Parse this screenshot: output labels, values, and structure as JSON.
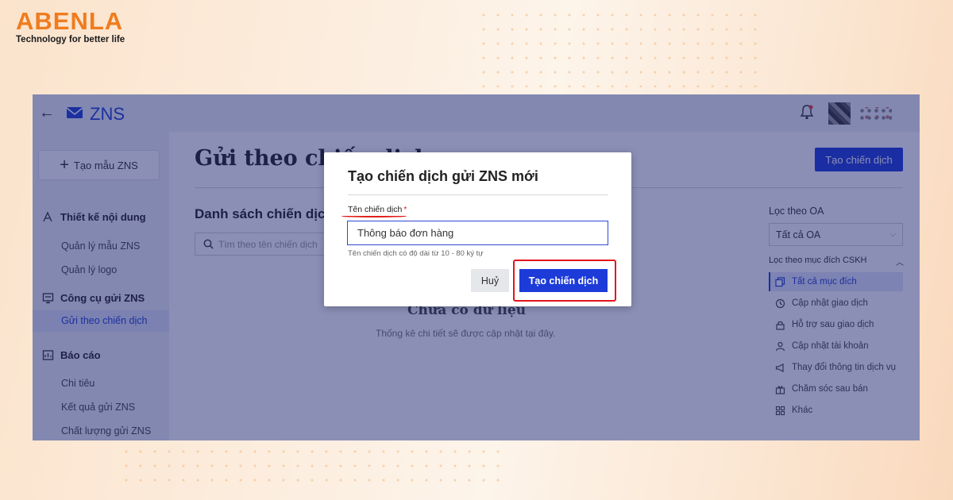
{
  "brand": {
    "name": "ABENLA",
    "tagline": "Technology for better life"
  },
  "app": {
    "title": "ZNS",
    "sidebar": {
      "create_template": "Tạo mẫu ZNS",
      "sections": [
        {
          "label": "Thiết kế nội dung",
          "items": [
            "Quản lý mẫu ZNS",
            "Quản lý logo"
          ]
        },
        {
          "label": "Công cụ gửi ZNS",
          "items": [
            "Gửi theo chiến dịch"
          ]
        },
        {
          "label": "Báo cáo",
          "items": [
            "Chi tiêu",
            "Kết quả gửi ZNS",
            "Chất lượng gửi ZNS"
          ]
        }
      ]
    },
    "main": {
      "page_title": "Gửi theo chiến dịch",
      "create_button": "Tạo chiến dịch",
      "list_title": "Danh sách chiến dịch",
      "search_placeholder": "Tìm theo tên chiến dịch",
      "empty_title": "Chưa có dữ liệu",
      "empty_desc": "Thống kê chi tiết sẽ được cập nhật tại đây."
    },
    "filters": {
      "oa_label": "Lọc theo OA",
      "oa_selected": "Tất cả OA",
      "purpose_label": "Lọc theo mục đích CSKH",
      "purposes": [
        "Tất cả mục đích",
        "Cập nhật giao dịch",
        "Hỗ trợ sau giao dịch",
        "Cập nhật tài khoản",
        "Thay đổi thông tin dịch vụ",
        "Chăm sóc sau bán",
        "Khác"
      ]
    }
  },
  "modal": {
    "title": "Tạo chiến dịch gửi ZNS mới",
    "field_label": "Tên chiến dịch",
    "required_mark": "*",
    "field_value": "Thông báo đơn hàng",
    "field_hint": "Tên chiến dịch có độ dài từ 10 - 80 ký tự",
    "cancel": "Huỷ",
    "confirm": "Tạo chiến dịch"
  },
  "colors": {
    "brand_orange": "#f07c1e",
    "primary_blue": "#1d3bd8",
    "highlight_red": "#e3141b",
    "overlay": "#18206e"
  }
}
